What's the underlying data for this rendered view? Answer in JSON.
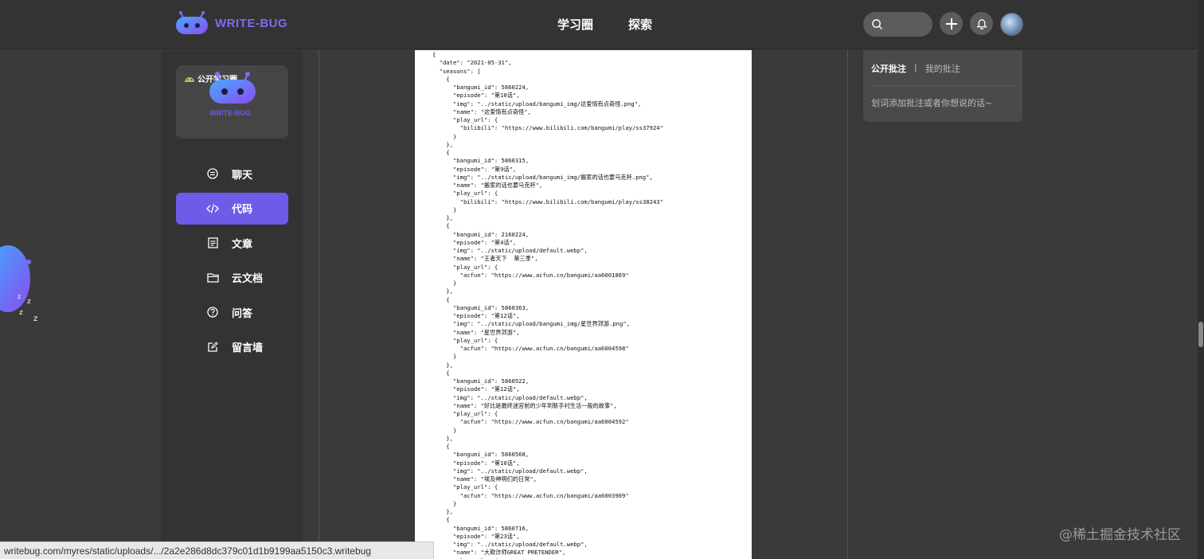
{
  "header": {
    "logo_text": "WRITE-BUG",
    "nav": [
      "学习圈",
      "探索"
    ]
  },
  "sidebar": {
    "card_label": "公开学习圈",
    "card_logo_text": "WRITE-BUG",
    "items": [
      {
        "label": "聊天",
        "icon": "chat-icon"
      },
      {
        "label": "代码",
        "icon": "code-icon",
        "active": true
      },
      {
        "label": "文章",
        "icon": "article-icon"
      },
      {
        "label": "云文档",
        "icon": "folder-icon"
      },
      {
        "label": "问答",
        "icon": "question-icon"
      },
      {
        "label": "留言墙",
        "icon": "edit-icon"
      }
    ]
  },
  "document": {
    "content": "{\n  \"date\": \"2021-05-31\",\n  \"seasons\": [\n    {\n      \"bangumi_id\": 5860224,\n      \"episode\": \"第10话\",\n      \"img\": \"../static/upload/bangumi_img/这爱情有点奇怪.png\",\n      \"name\": \"这爱情有点奇怪\",\n      \"play_url\": {\n        \"bilibili\": \"https://www.bilibili.com/bangumi/play/ss37924\"\n      }\n    },\n    {\n      \"bangumi_id\": 5860315,\n      \"episode\": \"第9话\",\n      \"img\": \"../static/upload/bangumi_img/搬家的话也要马克杯.png\",\n      \"name\": \"搬家的话也要马克杯\",\n      \"play_url\": {\n        \"bilibili\": \"https://www.bilibili.com/bangumi/play/ss38243\"\n      }\n    },\n    {\n      \"bangumi_id\": 2160224,\n      \"episode\": \"第4话\",\n      \"img\": \"../static/upload/default.webp\",\n      \"name\": \"王者天下  第三季\",\n      \"play_url\": {\n        \"acfun\": \"https://www.acfun.cn/bangumi/aa6001869\"\n      }\n    },\n    {\n      \"bangumi_id\": 5860363,\n      \"episode\": \"第12话\",\n      \"img\": \"../static/upload/bangumi_img/星世界郊游.png\",\n      \"name\": \"星世界郊游\",\n      \"play_url\": {\n        \"acfun\": \"https://www.acfun.cn/bangumi/aa6004598\"\n      }\n    },\n    {\n      \"bangumi_id\": 5860522,\n      \"episode\": \"第12话\",\n      \"img\": \"../static/upload/default.webp\",\n      \"name\": \"好比是最终迷宫前的少年到新手村生活一般的故事\",\n      \"play_url\": {\n        \"acfun\": \"https://www.acfun.cn/bangumi/aa6004592\"\n      }\n    },\n    {\n      \"bangumi_id\": 5860568,\n      \"episode\": \"第10话\",\n      \"img\": \"../static/upload/default.webp\",\n      \"name\": \"埃及神明们的日常\",\n      \"play_url\": {\n        \"acfun\": \"https://www.acfun.cn/bangumi/aa6003909\"\n      }\n    },\n    {\n      \"bangumi_id\": 5860716,\n      \"episode\": \"第23话\",\n      \"img\": \"../static/upload/default.webp\",\n      \"name\": \"大欺诈师GREAT PRETENDER\",\n      \"play_url\": {"
  },
  "annotation": {
    "tab_public": "公开批注",
    "separator": "|",
    "tab_mine": "我的批注",
    "hint": "划词添加批注或者你想说的话~"
  },
  "status": {
    "url": "writebug.com/myres/static/uploads/.../2a2e286d8dc379c01d1b9199aa5150c3.writebug"
  },
  "watermark": "@稀土掘金技术社区",
  "colors": {
    "accent": "#6c5ce7",
    "topbar": "#333333",
    "background": "#3a3a3a"
  }
}
